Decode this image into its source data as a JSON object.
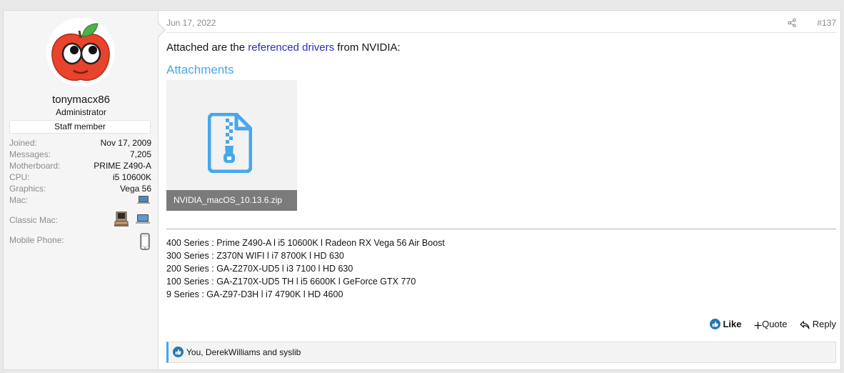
{
  "user": {
    "name": "tonymacx86",
    "title": "Administrator",
    "badge": "Staff member",
    "stats": [
      {
        "label": "Joined:",
        "value": "Nov 17, 2009"
      },
      {
        "label": "Messages:",
        "value": "7,205"
      },
      {
        "label": "Motherboard:",
        "value": "PRIME Z490-A"
      },
      {
        "label": "CPU:",
        "value": "i5 10600K"
      },
      {
        "label": "Graphics:",
        "value": "Vega 56"
      }
    ],
    "mac_label": "Mac:",
    "classic_mac_label": "Classic Mac:",
    "mobile_label": "Mobile Phone:"
  },
  "post": {
    "date": "Jun 17, 2022",
    "number": "#137",
    "text_before": "Attached are the ",
    "link_text": "referenced drivers",
    "text_after": " from NVIDIA:",
    "attachments_heading": "Attachments",
    "attachment_name": "NVIDIA_macOS_10.13.6.zip"
  },
  "signature": [
    {
      "series": "400 Series",
      "parts": [
        "Prime Z490-A",
        "i5 10600K",
        "Radeon RX Vega 56 Air Boost"
      ]
    },
    {
      "series": "300 Series",
      "parts": [
        "Z370N WIFI",
        "i7 8700K",
        "HD 630"
      ]
    },
    {
      "series": "200 Series",
      "parts": [
        "GA-Z270X-UD5",
        "i3 7100",
        "HD 630"
      ]
    },
    {
      "series": "100 Series",
      "parts": [
        "GA-Z170X-UD5 TH",
        "i5 6600K",
        "GeForce GTX 770"
      ]
    },
    {
      "series": "9 Series",
      "parts": [
        "GA-Z97-D3H",
        "i7 4790K",
        "HD 4600"
      ]
    }
  ],
  "actions": {
    "like": "Like",
    "quote": "Quote",
    "reply": "Reply"
  },
  "likes": {
    "text": "You, DerekWilliams and syslib"
  },
  "colors": {
    "accent": "#47a7eb",
    "link": "#2a2acc",
    "like_blue": "#2577b1"
  }
}
